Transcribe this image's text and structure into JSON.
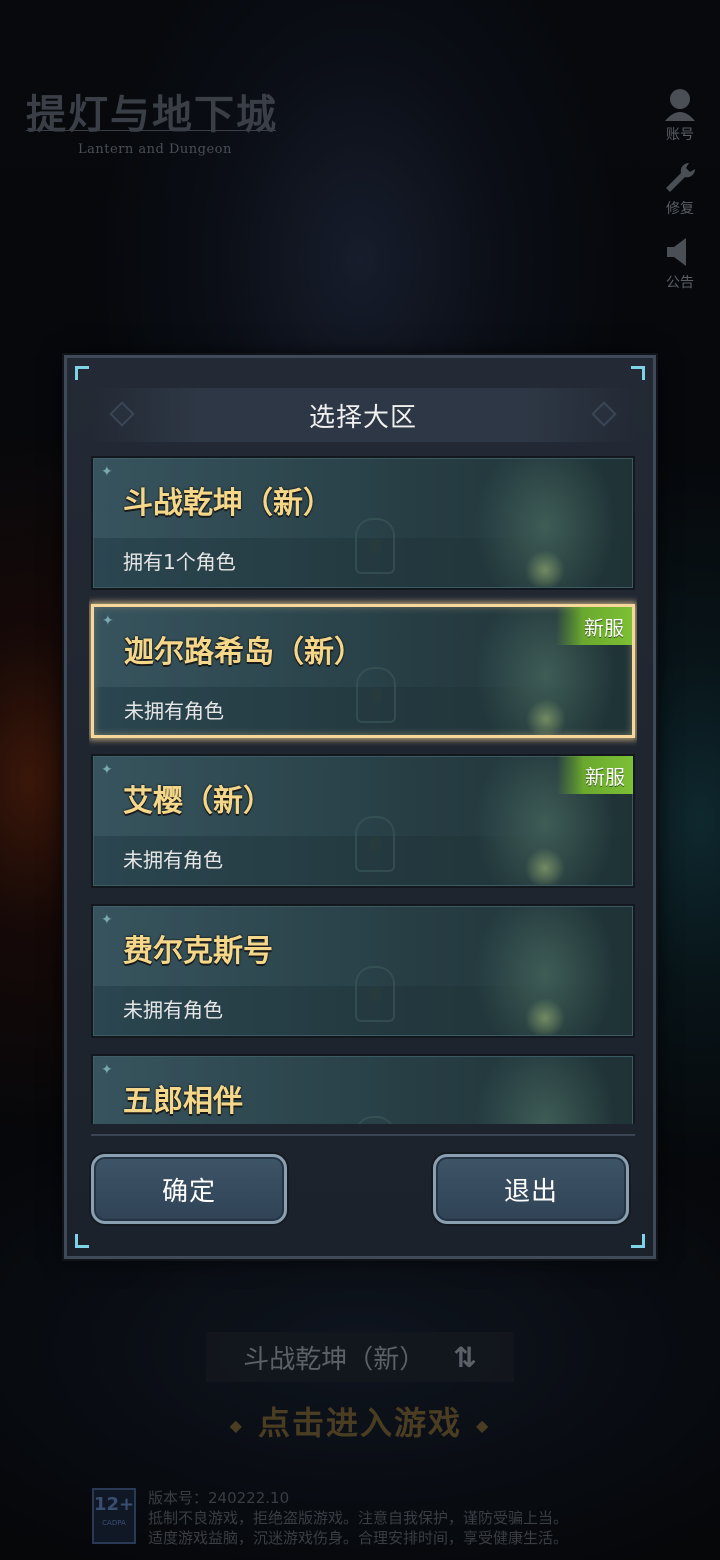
{
  "app": {
    "logo_cn": "提灯与地下城",
    "logo_en": "Lantern and Dungeon"
  },
  "side_menu": [
    {
      "label": "账号",
      "icon": "account-icon"
    },
    {
      "label": "修复",
      "icon": "wrench-icon"
    },
    {
      "label": "公告",
      "icon": "speaker-icon"
    }
  ],
  "dialog": {
    "title": "选择大区",
    "servers": [
      {
        "name": "斗战乾坤（新）",
        "status": "拥有1个角色",
        "badge": "",
        "selected": false
      },
      {
        "name": "迦尔路希岛（新）",
        "status": "未拥有角色",
        "badge": "新服",
        "selected": true
      },
      {
        "name": "艾樱（新）",
        "status": "未拥有角色",
        "badge": "新服",
        "selected": false
      },
      {
        "name": "费尔克斯号",
        "status": "未拥有角色",
        "badge": "",
        "selected": false
      },
      {
        "name": "五郎相伴",
        "status": "",
        "badge": "",
        "selected": false
      }
    ],
    "confirm_label": "确定",
    "exit_label": "退出"
  },
  "bottom": {
    "current_server": "斗战乾坤（新）",
    "enter_label": "点击进入游戏"
  },
  "footer": {
    "age_rating": "12+",
    "age_rating_sub": "CADPA",
    "version": "版本号：240222.10",
    "notice_line1": "抵制不良游戏，拒绝盗版游戏。注意自我保护，谨防受骗上当。",
    "notice_line2": "适度游戏益脑，沉迷游戏伤身。合理安排时间，享受健康生活。"
  },
  "colors": {
    "server_name": "#f5d78a",
    "selected_border": "#f7d79a",
    "new_badge": "#7cc034",
    "dialog_bg": "#1c222b"
  }
}
